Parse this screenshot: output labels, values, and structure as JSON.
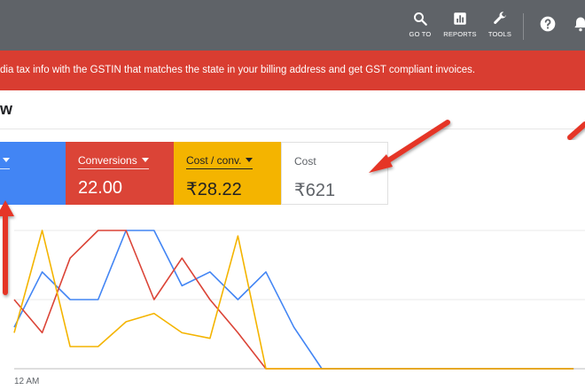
{
  "toolbar": {
    "goto_label": "GO TO",
    "reports_label": "REPORTS",
    "tools_label": "TOOLS"
  },
  "banner": {
    "text": "dia tax info with the GSTIN that matches the state in your billing address and get GST compliant invoices."
  },
  "page": {
    "heading": "w"
  },
  "scorecards": {
    "blue": {
      "value": ""
    },
    "conversions": {
      "label": "Conversions",
      "value": "22.00"
    },
    "cost_per_conv": {
      "label": "Cost / conv.",
      "value": "₹28.22"
    },
    "cost": {
      "label": "Cost",
      "value": "₹621"
    }
  },
  "colors": {
    "topbar": "#5f6368",
    "banner": "#d93d31",
    "blue": "#4285f4",
    "red": "#db4437",
    "yellow": "#f4b400",
    "annotation_arrow": "#e53427"
  },
  "chart_data": {
    "type": "line",
    "x_tick_labels": [
      "12 AM"
    ],
    "x": [
      0,
      1,
      2,
      3,
      4,
      5,
      6,
      7,
      8,
      9,
      10,
      11,
      12,
      13,
      14,
      15,
      16,
      17,
      18,
      19,
      20
    ],
    "ylim": [
      0,
      5
    ],
    "series": [
      {
        "color": "#4285f4",
        "values": [
          1.5,
          3.5,
          2.5,
          2.5,
          5,
          5,
          3,
          3.5,
          2.5,
          3.5,
          1.5,
          0,
          0,
          0,
          0,
          0,
          0,
          0,
          0,
          0,
          0
        ]
      },
      {
        "color": "#db4437",
        "values": [
          2.5,
          1.3,
          4,
          5,
          5,
          2.5,
          4,
          2.5,
          1.3,
          0,
          0,
          0,
          0,
          0,
          0,
          0,
          0,
          0,
          0,
          0,
          0
        ]
      },
      {
        "color": "#f4b400",
        "values": [
          1.3,
          5,
          0.8,
          0.8,
          1.7,
          2,
          1.3,
          1.1,
          4.8,
          0,
          0,
          0,
          0,
          0,
          0,
          0,
          0,
          0,
          0,
          0,
          0
        ]
      }
    ],
    "grid": true
  }
}
